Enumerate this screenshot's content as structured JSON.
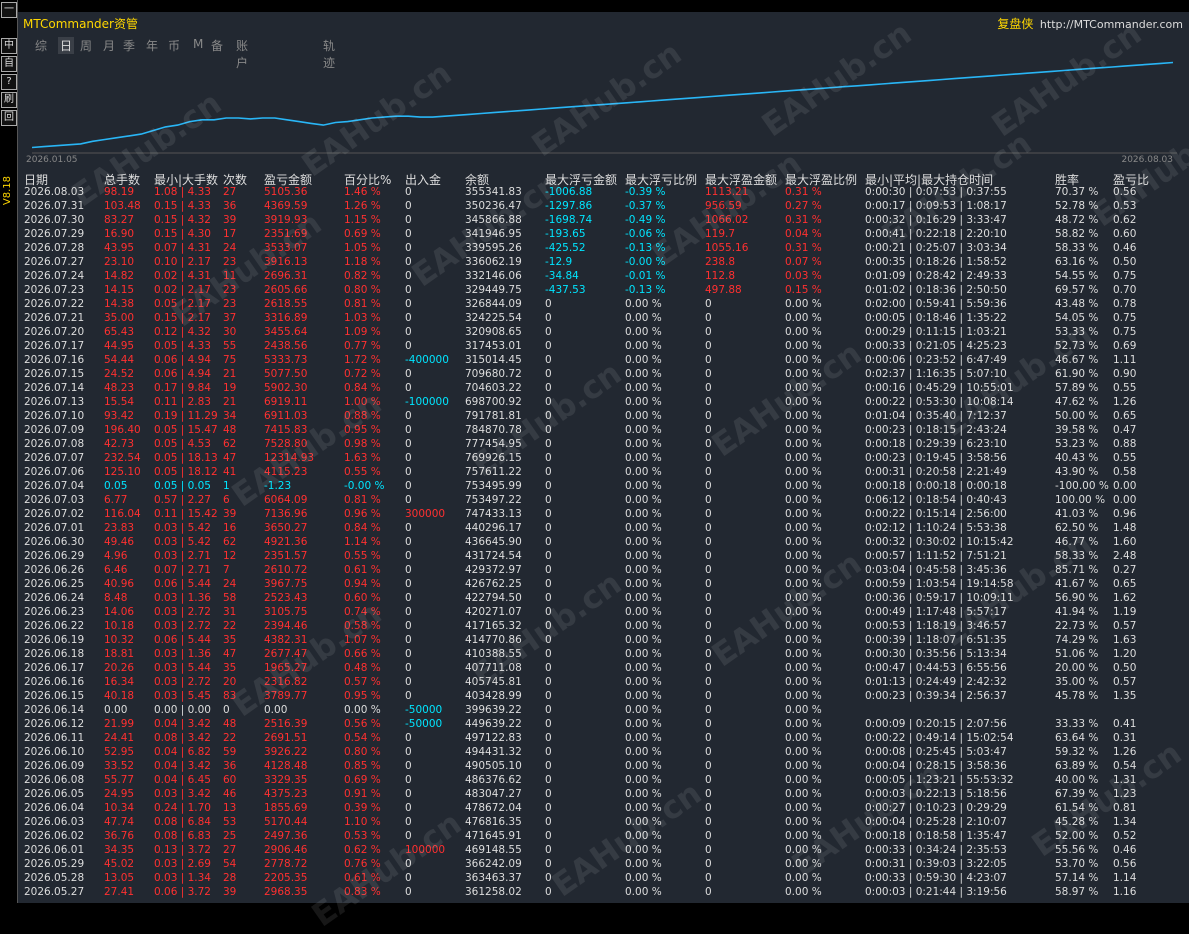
{
  "sidebar": {
    "buttons": [
      "一",
      "中",
      "自",
      "?",
      "刷",
      "回"
    ],
    "version": "V8.18"
  },
  "header": {
    "title": "MTCommander资管",
    "brand_cn": "复盘侠",
    "brand_url": "http://MTCommander.com"
  },
  "tabs": [
    "综",
    "日",
    "周",
    "月",
    "季",
    "年",
    "币",
    "M",
    "备",
    "账户",
    "轨迹"
  ],
  "active_tab": "日",
  "chart": {
    "x_start": "2026.01.05",
    "x_end": "2026.08.03"
  },
  "chart_data": {
    "type": "line",
    "x": [
      "2026.01.05",
      "2026.08.03"
    ],
    "series": [
      {
        "values": [
          0.05,
          0.06,
          0.07,
          0.08,
          0.09,
          0.12,
          0.14,
          0.16,
          0.18,
          0.2,
          0.24,
          0.28,
          0.3,
          0.34,
          0.36,
          0.36,
          0.38,
          0.38,
          0.37,
          0.38,
          0.38,
          0.36,
          0.34,
          0.32,
          0.3,
          0.33,
          0.34,
          0.36,
          0.38,
          0.39,
          0.4,
          0.4,
          0.39,
          0.39,
          0.4,
          0.41,
          0.42,
          0.43,
          0.44,
          0.45,
          0.46,
          0.47,
          0.48,
          0.49,
          0.5,
          0.51,
          0.52,
          0.53,
          0.54,
          0.55,
          0.56,
          0.57,
          0.58,
          0.59,
          0.6,
          0.61,
          0.62,
          0.63,
          0.64,
          0.65,
          0.66,
          0.67,
          0.68,
          0.69,
          0.7,
          0.71,
          0.72,
          0.73,
          0.74,
          0.75,
          0.76,
          0.77,
          0.78,
          0.79,
          0.8,
          0.81,
          0.82,
          0.83,
          0.84,
          0.85,
          0.86,
          0.87,
          0.88,
          0.89,
          0.9,
          0.91,
          0.92,
          0.93,
          0.94,
          0.95,
          0.96,
          0.97,
          0.98,
          0.99,
          1.0
        ],
        "color": "#29b6f6"
      }
    ],
    "ylim": [
      0,
      1.05
    ],
    "grid": false
  },
  "table": {
    "columns": [
      "日期",
      "总手数",
      "最小|大手数",
      "次数",
      "盈亏金额",
      "百分比%",
      "出入金",
      "余额",
      "最大浮亏金额",
      "最大浮亏比例",
      "最大浮盈金额",
      "最大浮盈比例",
      "最小|平均|最大持仓时间",
      "胜率",
      "盈亏比"
    ],
    "rows": [
      [
        "2026.08.03",
        "98.19",
        "1.08 | 4.33",
        "27",
        "5105.36",
        "1.46 %",
        "0",
        "355341.83",
        "-1006.88",
        "-0.39 %",
        "1113.21",
        "0.31 %",
        "0:00:30 | 0:07:53 | 0:37:55",
        "70.37 %",
        "0.56"
      ],
      [
        "2026.07.31",
        "103.48",
        "0.15 | 4.33",
        "36",
        "4369.59",
        "1.26 %",
        "0",
        "350236.47",
        "-1297.86",
        "-0.37 %",
        "956.59",
        "0.27 %",
        "0:00:17 | 0:09:53 | 1:08:17",
        "52.78 %",
        "0.53"
      ],
      [
        "2026.07.30",
        "83.27",
        "0.15 | 4.32",
        "39",
        "3919.93",
        "1.15 %",
        "0",
        "345866.88",
        "-1698.74",
        "-0.49 %",
        "1066.02",
        "0.31 %",
        "0:00:32 | 0:16:29 | 3:33:47",
        "48.72 %",
        "0.62"
      ],
      [
        "2026.07.29",
        "16.90",
        "0.15 | 4.30",
        "17",
        "2351.69",
        "0.69 %",
        "0",
        "341946.95",
        "-193.65",
        "-0.06 %",
        "119.7",
        "0.04 %",
        "0:00:41 | 0:22:18 | 2:20:10",
        "58.82 %",
        "0.60"
      ],
      [
        "2026.07.28",
        "43.95",
        "0.07 | 4.31",
        "24",
        "3533.07",
        "1.05 %",
        "0",
        "339595.26",
        "-425.52",
        "-0.13 %",
        "1055.16",
        "0.31 %",
        "0:00:21 | 0:25:07 | 3:03:34",
        "58.33 %",
        "0.46"
      ],
      [
        "2026.07.27",
        "23.10",
        "0.10 | 2.17",
        "23",
        "3916.13",
        "1.18 %",
        "0",
        "336062.19",
        "-12.9",
        "-0.00 %",
        "238.8",
        "0.07 %",
        "0:00:35 | 0:18:26 | 1:58:52",
        "63.16 %",
        "0.50"
      ],
      [
        "2026.07.24",
        "14.82",
        "0.02 | 4.31",
        "11",
        "2696.31",
        "0.82 %",
        "0",
        "332146.06",
        "-34.84",
        "-0.01 %",
        "112.8",
        "0.03 %",
        "0:01:09 | 0:28:42 | 2:49:33",
        "54.55 %",
        "0.75"
      ],
      [
        "2026.07.23",
        "14.15",
        "0.02 | 2.17",
        "23",
        "2605.66",
        "0.80 %",
        "0",
        "329449.75",
        "-437.53",
        "-0.13 %",
        "497.88",
        "0.15 %",
        "0:01:02 | 0:18:36 | 2:50:50",
        "69.57 %",
        "0.70"
      ],
      [
        "2026.07.22",
        "14.38",
        "0.05 | 2.17",
        "23",
        "2618.55",
        "0.81 %",
        "0",
        "326844.09",
        "0",
        "0.00 %",
        "0",
        "0.00 %",
        "0:02:00 | 0:59:41 | 5:59:36",
        "43.48 %",
        "0.78"
      ],
      [
        "2026.07.21",
        "35.00",
        "0.15 | 2.17",
        "37",
        "3316.89",
        "1.03 %",
        "0",
        "324225.54",
        "0",
        "0.00 %",
        "0",
        "0.00 %",
        "0:00:05 | 0:18:46 | 1:35:22",
        "54.05 %",
        "0.75"
      ],
      [
        "2026.07.20",
        "65.43",
        "0.12 | 4.32",
        "30",
        "3455.64",
        "1.09 %",
        "0",
        "320908.65",
        "0",
        "0.00 %",
        "0",
        "0.00 %",
        "0:00:29 | 0:11:15 | 1:03:21",
        "53.33 %",
        "0.75"
      ],
      [
        "2026.07.17",
        "44.95",
        "0.05 | 4.33",
        "55",
        "2438.56",
        "0.77 %",
        "0",
        "317453.01",
        "0",
        "0.00 %",
        "0",
        "0.00 %",
        "0:00:33 | 0:21:05 | 4:25:23",
        "52.73 %",
        "0.69"
      ],
      [
        "2026.07.16",
        "54.44",
        "0.06 | 4.94",
        "75",
        "5333.73",
        "1.72 %",
        "-400000",
        "315014.45",
        "0",
        "0.00 %",
        "0",
        "0.00 %",
        "0:00:06 | 0:23:52 | 6:47:49",
        "46.67 %",
        "1.11"
      ],
      [
        "2026.07.15",
        "24.52",
        "0.06 | 4.94",
        "21",
        "5077.50",
        "0.72 %",
        "0",
        "709680.72",
        "0",
        "0.00 %",
        "0",
        "0.00 %",
        "0:02:37 | 1:16:35 | 5:07:10",
        "61.90 %",
        "0.90"
      ],
      [
        "2026.07.14",
        "48.23",
        "0.17 | 9.84",
        "19",
        "5902.30",
        "0.84 %",
        "0",
        "704603.22",
        "0",
        "0.00 %",
        "0",
        "0.00 %",
        "0:00:16 | 0:45:29 | 10:55:01",
        "57.89 %",
        "0.55"
      ],
      [
        "2026.07.13",
        "15.54",
        "0.11 | 2.83",
        "21",
        "6919.11",
        "1.00 %",
        "-100000",
        "698700.92",
        "0",
        "0.00 %",
        "0",
        "0.00 %",
        "0:00:22 | 0:53:30 | 10:08:14",
        "47.62 %",
        "1.26"
      ],
      [
        "2026.07.10",
        "93.42",
        "0.19 | 11.29",
        "34",
        "6911.03",
        "0.88 %",
        "0",
        "791781.81",
        "0",
        "0.00 %",
        "0",
        "0.00 %",
        "0:01:04 | 0:35:40 | 7:12:37",
        "50.00 %",
        "0.65"
      ],
      [
        "2026.07.09",
        "196.40",
        "0.05 | 15.47",
        "48",
        "7415.83",
        "0.95 %",
        "0",
        "784870.78",
        "0",
        "0.00 %",
        "0",
        "0.00 %",
        "0:00:23 | 0:18:15 | 2:43:24",
        "39.58 %",
        "0.47"
      ],
      [
        "2026.07.08",
        "42.73",
        "0.05 | 4.53",
        "62",
        "7528.80",
        "0.98 %",
        "0",
        "777454.95",
        "0",
        "0.00 %",
        "0",
        "0.00 %",
        "0:00:18 | 0:29:39 | 6:23:10",
        "53.23 %",
        "0.88"
      ],
      [
        "2026.07.07",
        "232.54",
        "0.05 | 18.13",
        "47",
        "12314.93",
        "1.63 %",
        "0",
        "769926.15",
        "0",
        "0.00 %",
        "0",
        "0.00 %",
        "0:00:23 | 0:19:45 | 3:58:56",
        "40.43 %",
        "0.55"
      ],
      [
        "2026.07.06",
        "125.10",
        "0.05 | 18.12",
        "41",
        "4115.23",
        "0.55 %",
        "0",
        "757611.22",
        "0",
        "0.00 %",
        "0",
        "0.00 %",
        "0:00:31 | 0:20:58 | 2:21:49",
        "43.90 %",
        "0.58"
      ],
      [
        "2026.07.04",
        "0.05",
        "0.05 | 0.05",
        "1",
        "-1.23",
        "-0.00 %",
        "0",
        "753495.99",
        "0",
        "0.00 %",
        "0",
        "0.00 %",
        "0:00:18 | 0:00:18 | 0:00:18",
        "-100.00 %",
        "0.00"
      ],
      [
        "2026.07.03",
        "6.77",
        "0.57 | 2.27",
        "6",
        "6064.09",
        "0.81 %",
        "0",
        "753497.22",
        "0",
        "0.00 %",
        "0",
        "0.00 %",
        "0:06:12 | 0:18:54 | 0:40:43",
        "100.00 %",
        "0.00"
      ],
      [
        "2026.07.02",
        "116.04",
        "0.11 | 15.42",
        "39",
        "7136.96",
        "0.96 %",
        "300000",
        "747433.13",
        "0",
        "0.00 %",
        "0",
        "0.00 %",
        "0:00:22 | 0:15:14 | 2:56:00",
        "41.03 %",
        "0.96"
      ],
      [
        "2026.07.01",
        "23.83",
        "0.03 | 5.42",
        "16",
        "3650.27",
        "0.84 %",
        "0",
        "440296.17",
        "0",
        "0.00 %",
        "0",
        "0.00 %",
        "0:02:12 | 1:10:24 | 5:53:38",
        "62.50 %",
        "1.48"
      ],
      [
        "2026.06.30",
        "49.46",
        "0.03 | 5.42",
        "62",
        "4921.36",
        "1.14 %",
        "0",
        "436645.90",
        "0",
        "0.00 %",
        "0",
        "0.00 %",
        "0:00:32 | 0:30:02 | 10:15:42",
        "46.77 %",
        "1.60"
      ],
      [
        "2026.06.29",
        "4.96",
        "0.03 | 2.71",
        "12",
        "2351.57",
        "0.55 %",
        "0",
        "431724.54",
        "0",
        "0.00 %",
        "0",
        "0.00 %",
        "0:00:57 | 1:11:52 | 7:51:21",
        "58.33 %",
        "2.48"
      ],
      [
        "2026.06.26",
        "6.46",
        "0.07 | 2.71",
        "7",
        "2610.72",
        "0.61 %",
        "0",
        "429372.97",
        "0",
        "0.00 %",
        "0",
        "0.00 %",
        "0:03:04 | 0:45:58 | 3:45:36",
        "85.71 %",
        "0.27"
      ],
      [
        "2026.06.25",
        "40.96",
        "0.06 | 5.44",
        "24",
        "3967.75",
        "0.94 %",
        "0",
        "426762.25",
        "0",
        "0.00 %",
        "0",
        "0.00 %",
        "0:00:59 | 1:03:54 | 19:14:58",
        "41.67 %",
        "0.65"
      ],
      [
        "2026.06.24",
        "8.48",
        "0.03 | 1.36",
        "58",
        "2523.43",
        "0.60 %",
        "0",
        "422794.50",
        "0",
        "0.00 %",
        "0",
        "0.00 %",
        "0:00:36 | 0:59:17 | 10:09:11",
        "56.90 %",
        "1.62"
      ],
      [
        "2026.06.23",
        "14.06",
        "0.03 | 2.72",
        "31",
        "3105.75",
        "0.74 %",
        "0",
        "420271.07",
        "0",
        "0.00 %",
        "0",
        "0.00 %",
        "0:00:49 | 1:17:48 | 5:57:17",
        "41.94 %",
        "1.19"
      ],
      [
        "2026.06.22",
        "10.18",
        "0.03 | 2.72",
        "22",
        "2394.46",
        "0.58 %",
        "0",
        "417165.32",
        "0",
        "0.00 %",
        "0",
        "0.00 %",
        "0:00:53 | 1:18:19 | 3:46:57",
        "22.73 %",
        "0.57"
      ],
      [
        "2026.06.19",
        "10.32",
        "0.06 | 5.44",
        "35",
        "4382.31",
        "1.07 %",
        "0",
        "414770.86",
        "0",
        "0.00 %",
        "0",
        "0.00 %",
        "0:00:39 | 1:18:07 | 6:51:35",
        "74.29 %",
        "1.63"
      ],
      [
        "2026.06.18",
        "18.81",
        "0.03 | 1.36",
        "47",
        "2677.47",
        "0.66 %",
        "0",
        "410388.55",
        "0",
        "0.00 %",
        "0",
        "0.00 %",
        "0:00:30 | 0:35:56 | 5:13:34",
        "51.06 %",
        "1.20"
      ],
      [
        "2026.06.17",
        "20.26",
        "0.03 | 5.44",
        "35",
        "1965.27",
        "0.48 %",
        "0",
        "407711.08",
        "0",
        "0.00 %",
        "0",
        "0.00 %",
        "0:00:47 | 0:44:53 | 6:55:56",
        "20.00 %",
        "0.50"
      ],
      [
        "2026.06.16",
        "16.34",
        "0.03 | 2.72",
        "20",
        "2316.82",
        "0.57 %",
        "0",
        "405745.81",
        "0",
        "0.00 %",
        "0",
        "0.00 %",
        "0:01:13 | 0:24:49 | 2:42:32",
        "35.00 %",
        "0.57"
      ],
      [
        "2026.06.15",
        "40.18",
        "0.03 | 5.45",
        "83",
        "3789.77",
        "0.95 %",
        "0",
        "403428.99",
        "0",
        "0.00 %",
        "0",
        "0.00 %",
        "0:00:23 | 0:39:34 | 2:56:37",
        "45.78 %",
        "1.35"
      ],
      [
        "2026.06.14",
        "0.00",
        "0.00 | 0.00",
        "0",
        "0.00",
        "0.00 %",
        "-50000",
        "399639.22",
        "0",
        "0.00 %",
        "0",
        "0.00 %",
        "",
        "",
        ""
      ],
      [
        "2026.06.12",
        "21.99",
        "0.04 | 3.42",
        "48",
        "2516.39",
        "0.56 %",
        "-50000",
        "449639.22",
        "0",
        "0.00 %",
        "0",
        "0.00 %",
        "0:00:09 | 0:20:15 | 2:07:56",
        "33.33 %",
        "0.41"
      ],
      [
        "2026.06.11",
        "24.41",
        "0.08 | 3.42",
        "22",
        "2691.51",
        "0.54 %",
        "0",
        "497122.83",
        "0",
        "0.00 %",
        "0",
        "0.00 %",
        "0:00:22 | 0:49:14 | 15:02:54",
        "63.64 %",
        "0.31"
      ],
      [
        "2026.06.10",
        "52.95",
        "0.04 | 6.82",
        "59",
        "3926.22",
        "0.80 %",
        "0",
        "494431.32",
        "0",
        "0.00 %",
        "0",
        "0.00 %",
        "0:00:08 | 0:25:45 | 5:03:47",
        "59.32 %",
        "1.26"
      ],
      [
        "2026.06.09",
        "33.52",
        "0.04 | 3.42",
        "36",
        "4128.48",
        "0.85 %",
        "0",
        "490505.10",
        "0",
        "0.00 %",
        "0",
        "0.00 %",
        "0:00:04 | 0:28:15 | 3:58:36",
        "63.89 %",
        "0.54"
      ],
      [
        "2026.06.08",
        "55.77",
        "0.04 | 6.45",
        "60",
        "3329.35",
        "0.69 %",
        "0",
        "486376.62",
        "0",
        "0.00 %",
        "0",
        "0.00 %",
        "0:00:05 | 1:23:21 | 55:53:32",
        "40.00 %",
        "1.31"
      ],
      [
        "2026.06.05",
        "24.95",
        "0.03 | 3.42",
        "46",
        "4375.23",
        "0.91 %",
        "0",
        "483047.27",
        "0",
        "0.00 %",
        "0",
        "0.00 %",
        "0:00:03 | 0:22:13 | 5:18:56",
        "67.39 %",
        "1.23"
      ],
      [
        "2026.06.04",
        "10.34",
        "0.24 | 1.70",
        "13",
        "1855.69",
        "0.39 %",
        "0",
        "478672.04",
        "0",
        "0.00 %",
        "0",
        "0.00 %",
        "0:00:27 | 0:10:23 | 0:29:29",
        "61.54 %",
        "0.81"
      ],
      [
        "2026.06.03",
        "47.74",
        "0.08 | 6.84",
        "53",
        "5170.44",
        "1.10 %",
        "0",
        "476816.35",
        "0",
        "0.00 %",
        "0",
        "0.00 %",
        "0:00:04 | 0:25:28 | 2:10:07",
        "45.28 %",
        "1.34"
      ],
      [
        "2026.06.02",
        "36.76",
        "0.08 | 6.83",
        "25",
        "2497.36",
        "0.53 %",
        "0",
        "471645.91",
        "0",
        "0.00 %",
        "0",
        "0.00 %",
        "0:00:18 | 0:18:58 | 1:35:47",
        "52.00 %",
        "0.52"
      ],
      [
        "2026.06.01",
        "34.35",
        "0.13 | 3.72",
        "27",
        "2906.46",
        "0.62 %",
        "100000",
        "469148.55",
        "0",
        "0.00 %",
        "0",
        "0.00 %",
        "0:00:33 | 0:34:24 | 2:35:53",
        "55.56 %",
        "0.46"
      ],
      [
        "2026.05.29",
        "45.02",
        "0.03 | 2.69",
        "54",
        "2778.72",
        "0.76 %",
        "0",
        "366242.09",
        "0",
        "0.00 %",
        "0",
        "0.00 %",
        "0:00:31 | 0:39:03 | 3:22:05",
        "53.70 %",
        "0.56"
      ],
      [
        "2026.05.28",
        "13.05",
        "0.03 | 1.34",
        "28",
        "2205.35",
        "0.61 %",
        "0",
        "363463.37",
        "0",
        "0.00 %",
        "0",
        "0.00 %",
        "0:00:33 | 0:59:30 | 4:23:07",
        "57.14 %",
        "1.14"
      ],
      [
        "2026.05.27",
        "27.41",
        "0.06 | 3.72",
        "39",
        "2968.35",
        "0.83 %",
        "0",
        "361258.02",
        "0",
        "0.00 %",
        "0",
        "0.00 %",
        "0:00:03 | 0:21:44 | 3:19:56",
        "58.97 %",
        "1.16"
      ]
    ]
  },
  "watermark": "EAHub.cn",
  "colors": {
    "positive": "#ff3030",
    "negative": "#00e5ff",
    "line": "#29b6f6",
    "title": "#ffd700"
  }
}
